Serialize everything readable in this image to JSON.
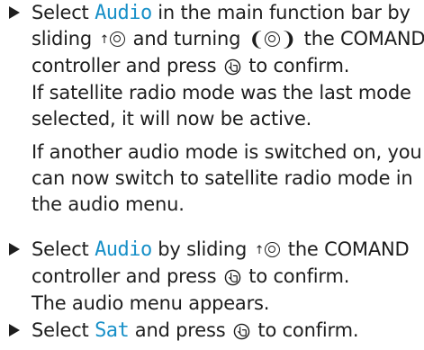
{
  "steps": [
    {
      "lines": [
        {
          "parts": [
            {
              "t": "Select "
            },
            {
              "hl": "Audio"
            },
            {
              "t": " in the main function bar by"
            }
          ]
        },
        {
          "parts": [
            {
              "t": "sliding "
            },
            {
              "icon": "slide-up-controller-icon"
            },
            {
              "t": " and turning "
            },
            {
              "icon": "turn-controller-icon"
            },
            {
              "t": " the COMAND"
            }
          ]
        },
        {
          "parts": [
            {
              "t": "controller and press "
            },
            {
              "icon": "press-controller-icon"
            },
            {
              "t": " to confirm."
            }
          ]
        },
        {
          "parts": [
            {
              "t": "If satellite radio mode was the last mode"
            }
          ]
        },
        {
          "parts": [
            {
              "t": "selected, it will now be active."
            }
          ]
        }
      ],
      "extra": [
        "If another audio mode is switched on, you",
        "can now switch to satellite radio mode in",
        "the audio menu."
      ]
    },
    {
      "lines": [
        {
          "parts": [
            {
              "t": "Select "
            },
            {
              "hl": "Audio"
            },
            {
              "t": " by sliding "
            },
            {
              "icon": "slide-up-controller-icon"
            },
            {
              "t": " the COMAND"
            }
          ]
        },
        {
          "parts": [
            {
              "t": "controller and press "
            },
            {
              "icon": "press-controller-icon"
            },
            {
              "t": " to confirm."
            }
          ]
        },
        {
          "parts": [
            {
              "t": "The audio menu appears."
            }
          ]
        }
      ]
    },
    {
      "lines": [
        {
          "parts": [
            {
              "t": "Select "
            },
            {
              "hl": "Sat"
            },
            {
              "t": " and press "
            },
            {
              "icon": "press-controller-icon"
            },
            {
              "t": " to confirm."
            }
          ]
        }
      ]
    }
  ]
}
